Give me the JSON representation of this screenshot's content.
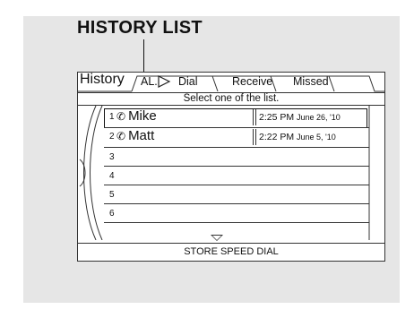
{
  "callout": {
    "label": "HISTORY LIST"
  },
  "screen": {
    "title": "History",
    "tabs": [
      {
        "label": "AL."
      },
      {
        "label": "Dial"
      },
      {
        "label": "Receive"
      },
      {
        "label": "Missed"
      }
    ],
    "instruction": "Select one of the list.",
    "rows": [
      {
        "index": "1",
        "name": "Mike",
        "time": "2:25 PM",
        "date": "June 26, '10",
        "selected": true
      },
      {
        "index": "2",
        "name": "Matt",
        "time": "2:22 PM",
        "date": "June  5, '10",
        "selected": false
      },
      {
        "index": "3",
        "name": "",
        "time": "",
        "date": ""
      },
      {
        "index": "4",
        "name": "",
        "time": "",
        "date": ""
      },
      {
        "index": "5",
        "name": "",
        "time": "",
        "date": ""
      },
      {
        "index": "6",
        "name": "",
        "time": "",
        "date": ""
      }
    ],
    "footer": "STORE SPEED DIAL"
  }
}
